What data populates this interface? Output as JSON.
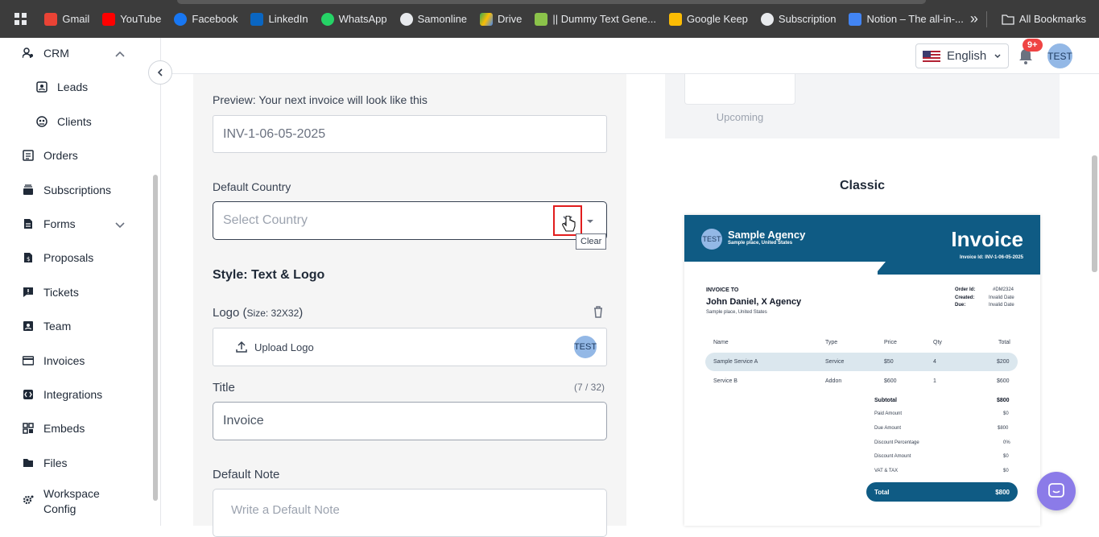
{
  "bookmarks": {
    "items": [
      {
        "label": "Gmail",
        "color": "#ea4335"
      },
      {
        "label": "YouTube",
        "color": "#ff0000"
      },
      {
        "label": "Facebook",
        "color": "#1877f2"
      },
      {
        "label": "LinkedIn",
        "color": "#0a66c2"
      },
      {
        "label": "WhatsApp",
        "color": "#25d366"
      },
      {
        "label": "Samonline",
        "color": "#9aa0a6"
      },
      {
        "label": "Drive",
        "color": "#34a853"
      },
      {
        "label": "|| Dummy Text Gene...",
        "color": "#8bc34a"
      },
      {
        "label": "Google Keep",
        "color": "#fbbc04"
      },
      {
        "label": "Subscription",
        "color": "#9aa0a6"
      },
      {
        "label": "Notion – The all-in-...",
        "color": "#4285f4"
      }
    ],
    "more": "»",
    "all_bookmarks": "All Bookmarks"
  },
  "sidebar": {
    "items": [
      {
        "label": "CRM",
        "icon": "crm-icon"
      },
      {
        "label": "Leads",
        "icon": "leads-icon"
      },
      {
        "label": "Clients",
        "icon": "clients-icon"
      },
      {
        "label": "Orders",
        "icon": "orders-icon"
      },
      {
        "label": "Subscriptions",
        "icon": "subscriptions-icon"
      },
      {
        "label": "Forms",
        "icon": "forms-icon"
      },
      {
        "label": "Proposals",
        "icon": "proposals-icon"
      },
      {
        "label": "Tickets",
        "icon": "tickets-icon"
      },
      {
        "label": "Team",
        "icon": "team-icon"
      },
      {
        "label": "Invoices",
        "icon": "invoices-icon"
      },
      {
        "label": "Integrations",
        "icon": "integrations-icon"
      },
      {
        "label": "Embeds",
        "icon": "embeds-icon"
      },
      {
        "label": "Files",
        "icon": "files-icon"
      },
      {
        "label": "Workspace",
        "icon": "workspace-config-icon"
      }
    ],
    "workspace_line2": "Config"
  },
  "header": {
    "language": "English",
    "notif_badge": "9+",
    "avatar": "TEST"
  },
  "form": {
    "preview_label": "Preview: Your next invoice will look like this",
    "preview_value": "INV-1-06-05-2025",
    "country_label": "Default Country",
    "country_placeholder": "Select Country",
    "clear_tooltip": "Clear",
    "style_title": "Style: Text & Logo",
    "logo_label": "Logo (",
    "logo_size": "Size: 32X32",
    "logo_close": ")",
    "upload_label": "Upload Logo",
    "logo_avatar": "TEST",
    "title_label": "Title",
    "title_counter": "(7 / 32)",
    "title_value": "Invoice",
    "note_label": "Default Note",
    "note_placeholder": "Write a Default Note"
  },
  "templates": {
    "upcoming_label": "Upcoming",
    "classic_label": "Classic"
  },
  "invoice_preview": {
    "logo": "TEST",
    "agency": "Sample Agency",
    "agency_place": "Sample place, United States",
    "title": "Invoice",
    "invoice_id": "Invoice Id: INV-1-06-05-2025",
    "invoice_to": "INVOICE TO",
    "client": "John Daniel, X Agency",
    "client_place": "Sample place, United States",
    "order_id_label": "Order Id:",
    "order_id": "#DM2324",
    "created_label": "Created:",
    "created": "Invalid Date",
    "due_label": "Due:",
    "due": "Invalid Date",
    "columns": [
      "Name",
      "Type",
      "Price",
      "Qty",
      "Total"
    ],
    "rows": [
      [
        "Sample Service A",
        "Service",
        "$50",
        "4",
        "$200"
      ],
      [
        "Service B",
        "Addon",
        "$600",
        "1",
        "$600"
      ]
    ],
    "summary": [
      [
        "Subtotal",
        "$800"
      ],
      [
        "Paid Amount",
        "$0"
      ],
      [
        "Due Amount",
        "$800"
      ],
      [
        "Discount Percentage",
        "0%"
      ],
      [
        "Discount Amount",
        "$0"
      ],
      [
        "VAT & TAX",
        "$0"
      ]
    ],
    "total_label": "Total",
    "total_value": "$800"
  }
}
